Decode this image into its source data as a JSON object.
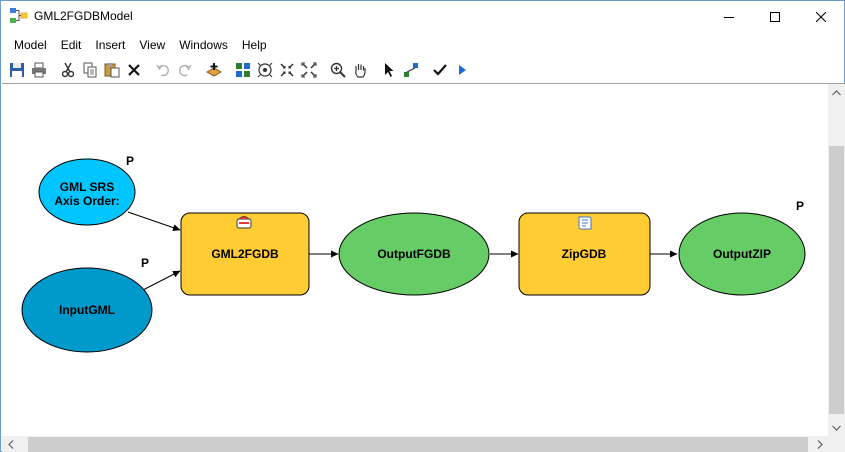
{
  "window": {
    "title": "GML2FGDBModel",
    "app_icon": "model-builder-icon",
    "controls": [
      "minimize-icon",
      "maximize-icon",
      "close-icon"
    ]
  },
  "menu": {
    "items": [
      "Model",
      "Edit",
      "Insert",
      "View",
      "Windows",
      "Help"
    ]
  },
  "toolbar": {
    "buttons": [
      "save-icon",
      "print-icon",
      "cut-icon",
      "copy-icon",
      "paste-icon",
      "delete-icon",
      "undo-icon",
      "redo-icon",
      "add-data-icon",
      "auto-layout-icon",
      "full-extent-icon",
      "fixed-zoom-in-icon",
      "fixed-zoom-out-icon",
      "zoom-in-icon",
      "pan-icon",
      "select-icon",
      "connect-icon",
      "validate-icon",
      "run-icon"
    ]
  },
  "model": {
    "nodes": {
      "gml_srs": {
        "line1": "GML SRS",
        "line2": "Axis Order:",
        "param_flag": "P",
        "color": "#00c5ff"
      },
      "input_gml": {
        "label": "InputGML",
        "param_flag": "P",
        "color": "#0099cc"
      },
      "gml2fgdb": {
        "label": "GML2FGDB",
        "icon": "tool-script-icon",
        "color": "#ffcc33"
      },
      "output_fgdb": {
        "label": "OutputFGDB",
        "color": "#66cc66"
      },
      "zipgdb": {
        "label": "ZipGDB",
        "icon": "script-tool-icon",
        "color": "#ffcc33"
      },
      "output_zip": {
        "label": "OutputZIP",
        "param_flag": "P",
        "color": "#66cc66"
      }
    }
  }
}
